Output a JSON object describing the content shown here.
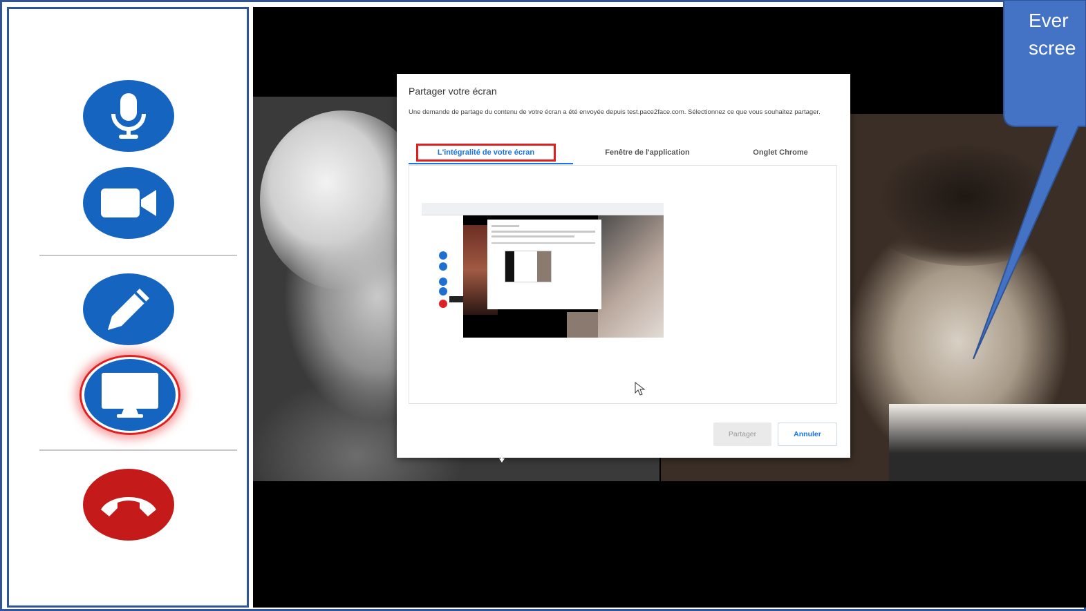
{
  "dialog": {
    "title": "Partager votre écran",
    "description": "Une demande de partage du contenu de votre écran a été envoyée depuis test.pace2face.com. Sélectionnez ce que vous souhaitez partager.",
    "tabs": [
      {
        "label": "L'intégralité de votre écran",
        "selected": true
      },
      {
        "label": "Fenêtre de l'application",
        "selected": false
      },
      {
        "label": "Onglet Chrome",
        "selected": false
      }
    ],
    "share_button": "Partager",
    "cancel_button": "Annuler"
  },
  "sidebar": {
    "buttons": [
      {
        "name": "microphone",
        "icon": "microphone-icon"
      },
      {
        "name": "camera",
        "icon": "video-camera-icon"
      },
      {
        "name": "annotate",
        "icon": "pencil-icon"
      },
      {
        "name": "screen-share",
        "icon": "monitor-icon",
        "highlighted": true
      },
      {
        "name": "hang-up",
        "icon": "phone-hangup-icon"
      }
    ]
  },
  "callout": {
    "line1": "Ever",
    "line2": "scree"
  },
  "colors": {
    "accent": "#1565c0",
    "hangup": "#c41a1a",
    "highlight": "#e01e1e",
    "callout": "#4472c4",
    "frame": "#2f5597"
  }
}
